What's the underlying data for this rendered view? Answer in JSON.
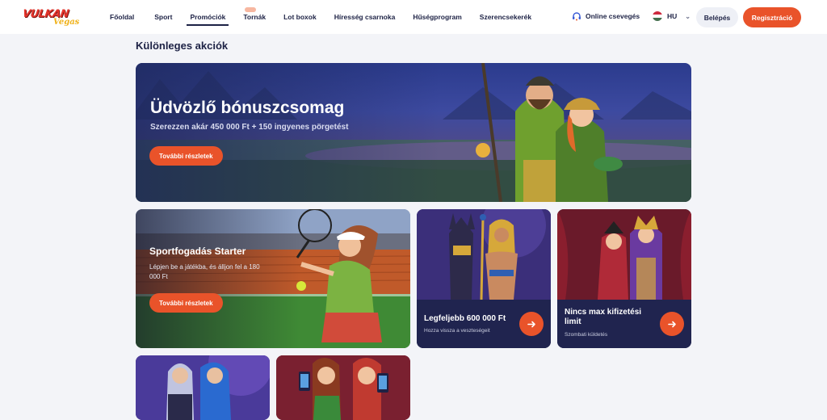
{
  "brand": {
    "name": "VULKAN",
    "tagline": "Vegas"
  },
  "nav": {
    "items": [
      "Főoldal",
      "Sport",
      "Promóciók",
      "Tornák",
      "Lot boxok",
      "Híresség csarnoka",
      "Hűségprogram",
      "Szerencsekerék"
    ],
    "active": "Promóciók"
  },
  "header": {
    "chat_label": "Online csevegés",
    "language": "HU",
    "login_label": "Belépés",
    "register_label": "Regisztráció"
  },
  "page": {
    "title": "Különleges akciók"
  },
  "hero": {
    "title": "Üdvözlő bónuszcsomag",
    "subtitle": "Szerezzen akár 450 000 Ft + 150 ingyenes pörgetést",
    "button": "További részletek"
  },
  "sport": {
    "title": "Sportfogadás Starter",
    "desc": "Lépjen be a játékba, és álljon fel a 180 000 Ft",
    "button": "További részletek"
  },
  "promo_cashback": {
    "title": "Legfeljebb 600 000 Ft",
    "desc": "Hozza vissza a veszteségeit"
  },
  "promo_nolimit": {
    "title": "Nincs max kifizetési limit",
    "desc": "Szombati küldetés"
  },
  "colors": {
    "accent": "#e9532a",
    "navy": "#1d2245"
  }
}
